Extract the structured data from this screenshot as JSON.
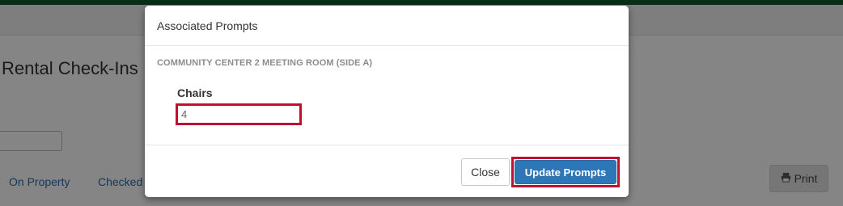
{
  "background": {
    "page_title": "Rental Check-Ins",
    "tabs": [
      {
        "label": "On Property"
      },
      {
        "label": "Checked Out"
      }
    ],
    "print_label": "Print",
    "print_icon": "printer-icon",
    "colors": {
      "top_bar": "#0f5a2e",
      "link": "#2a6bb0"
    }
  },
  "modal": {
    "title": "Associated Prompts",
    "section_label": "COMMUNITY CENTER 2 MEETING ROOM (SIDE A)",
    "fields": [
      {
        "label": "Chairs",
        "value": "4"
      }
    ],
    "close_label": "Close",
    "update_label": "Update Prompts",
    "colors": {
      "primary_button": "#2d76b8",
      "highlight_border": "#c0102e"
    }
  }
}
